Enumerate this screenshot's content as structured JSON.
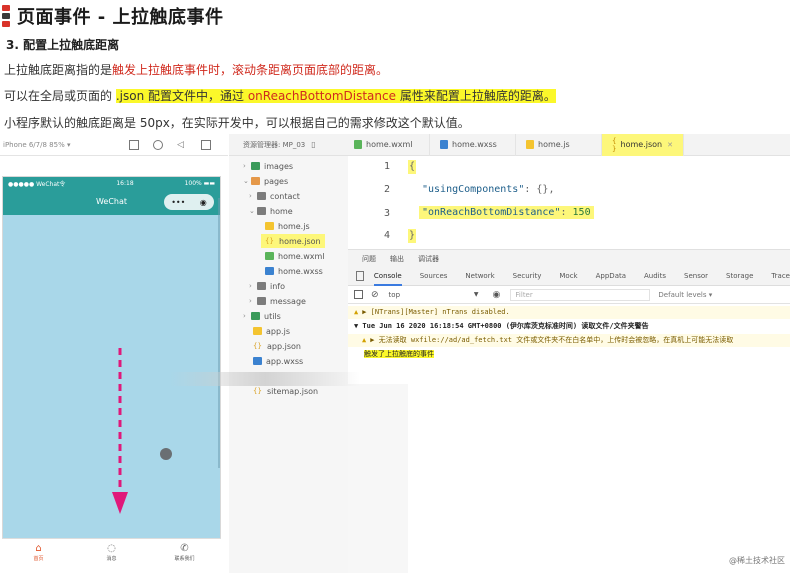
{
  "article": {
    "title": "页面事件 - 上拉触底事件",
    "title_mark_colors": [
      "#d9332a",
      "#3a3a3a",
      "#d9332a"
    ],
    "section": "3. 配置上拉触底距离",
    "p1_before": "上拉触底距离指的是",
    "p1_red": "触发上拉触底事件时，滚动条距离页面底部的距离。",
    "p2_before": "可以在全局或页面的 ",
    "p2_json": ".json",
    "p2_mid": " 配置文件中，通过 ",
    "p2_prop": "onReachBottomDistance",
    "p2_after": " 属性来配置上拉触底的距离。",
    "p3": "小程序默认的触底距离是 50px，在实际开发中，可以根据自己的需求修改这个默认值。"
  },
  "simulator": {
    "device": "iPhone 6/7/8 85% ▾",
    "status_left": "●●●●● WeChat令",
    "status_time": "16:18",
    "status_right": "100% ▬▬",
    "nav_title": "WeChat",
    "capsule_dots": "•••",
    "capsule_close": "◉",
    "tabs": [
      {
        "icon": "⌂",
        "label": "首页"
      },
      {
        "icon": "◌",
        "label": "消息"
      },
      {
        "icon": "✆",
        "label": "联系我们"
      }
    ],
    "arrow_color": "#e0187a"
  },
  "editor": {
    "explorer_title": "资源管理器: MP_03",
    "tabs": [
      {
        "label": "home.wxml",
        "icon_color": "#5ab45a"
      },
      {
        "label": "home.wxss",
        "icon_color": "#3b82d0"
      },
      {
        "label": "home.js",
        "icon_color": "#f4c430"
      },
      {
        "label": "home.json",
        "icon": "{ }",
        "close": "✕"
      }
    ],
    "tree": {
      "images": "images",
      "pages": "pages",
      "contact": "contact",
      "home": "home",
      "home_js": "home.js",
      "home_json": "home.json",
      "home_wxml": "home.wxml",
      "home_wxss": "home.wxss",
      "info": "info",
      "message": "message",
      "utils": "utils",
      "app_js": "app.js",
      "app_json": "app.json",
      "app_wxss": "app.wxss",
      "sitemap_json": "sitemap.json",
      "json_icon": "{}"
    },
    "code": {
      "line_numbers": [
        "1",
        "2",
        "3",
        "4"
      ],
      "line1": "{",
      "line2_key": "\"usingComponents\"",
      "line2_rest": ": {},",
      "line3_key": "\"onReachBottomDistance\"",
      "line3_colon": ": ",
      "line3_value": "150",
      "line4": "}"
    }
  },
  "devtools": {
    "panel_tabs": [
      "问题",
      "输出",
      "调试器"
    ],
    "tabs": [
      "Console",
      "Sources",
      "Network",
      "Security",
      "Mock",
      "AppData",
      "Audits",
      "Sensor",
      "Storage",
      "Trace"
    ],
    "context": "top",
    "context_caret": "▼",
    "filter_placeholder": "Filter",
    "levels": "Default levels ▾",
    "logs": {
      "l1": "▶ [NTrans][Master] nTrans disabled.",
      "l2": "▼ Tue Jun 16 2020 16:18:54 GMT+0800 (伊尔库茨克标准时间) 读取文件/文件夹警告",
      "l3": "▶ 无法读取 wxfile://ad/ad_fetch.txt 文件或文件夹不在白名单中，上传时会被忽略，在真机上可能无法读取",
      "l4": "触发了上拉触底的事件"
    }
  },
  "watermark": "@稀土技术社区"
}
